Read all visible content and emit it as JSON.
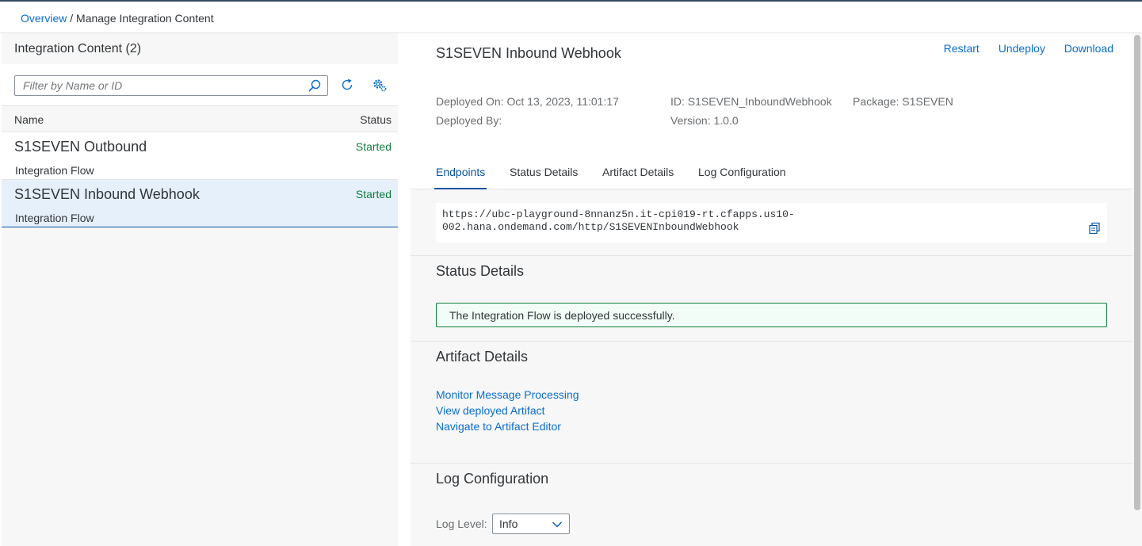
{
  "breadcrumb": {
    "root": "Overview",
    "separator": " / ",
    "current": "Manage Integration Content"
  },
  "left": {
    "header": "Integration Content (2)",
    "search_placeholder": "Filter by Name or ID",
    "columns": {
      "name": "Name",
      "status": "Status"
    },
    "items": [
      {
        "title": "S1SEVEN Outbound",
        "type": "Integration Flow",
        "status": "Started",
        "selected": false
      },
      {
        "title": "S1SEVEN Inbound Webhook",
        "type": "Integration Flow",
        "status": "Started",
        "selected": true
      }
    ]
  },
  "detail": {
    "title": "S1SEVEN Inbound Webhook",
    "actions": {
      "restart": "Restart",
      "undeploy": "Undeploy",
      "download": "Download"
    },
    "deployed_on": "Deployed On: Oct 13, 2023, 11:01:17",
    "deployed_by": "Deployed By:",
    "id": "ID: S1SEVEN_InboundWebhook",
    "version": "Version: 1.0.0",
    "package": "Package: S1SEVEN",
    "tabs": [
      "Endpoints",
      "Status Details",
      "Artifact Details",
      "Log Configuration"
    ],
    "endpoint_line1": "https://ubc-playground-8nnanz5n.it-cpi019-rt.cfapps.us10-",
    "endpoint_line2": "002.hana.ondemand.com/http/S1SEVENInboundWebhook",
    "status_section": "Status Details",
    "status_message": "The Integration Flow is deployed successfully.",
    "artifact_section": "Artifact Details",
    "links": [
      "Monitor Message Processing",
      "View deployed Artifact",
      "Navigate to Artifact Editor"
    ],
    "log_section": "Log Configuration",
    "log_label": "Log Level:",
    "log_value": "Info"
  },
  "colors": {
    "accent": "#0a6ed1",
    "success": "#107e3e",
    "selected": "#e5f0fa"
  }
}
